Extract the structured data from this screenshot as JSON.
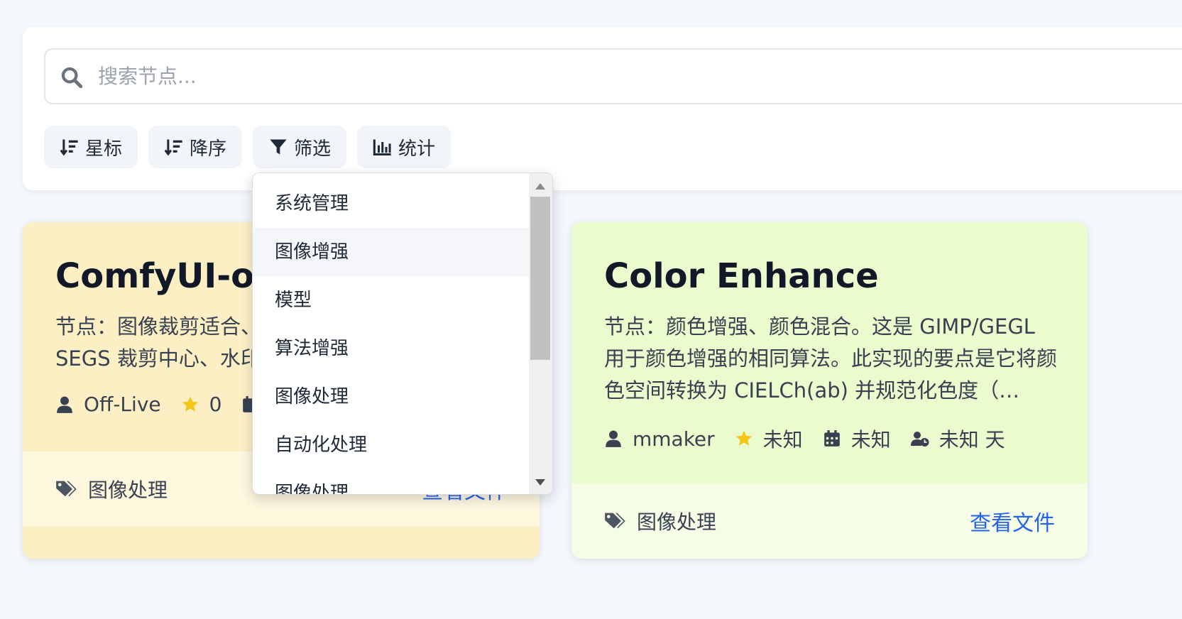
{
  "search": {
    "placeholder": "搜索节点..."
  },
  "toolbar": {
    "star_label": "星标",
    "order_label": "降序",
    "filter_label": "筛选",
    "stats_label": "统计"
  },
  "dropdown": {
    "items": [
      "系统管理",
      "图像增强",
      "模型",
      "算法增强",
      "图像处理",
      "自动化处理",
      "图像处理"
    ],
    "selected": "图像增强"
  },
  "cards": [
    {
      "title": "ComfyUI-off",
      "desc_line1": "节点：图像裁剪适合、",
      "desc_line2": "SEGS 裁剪中心、水印",
      "author": "Off-Live",
      "stars": "0",
      "tag": "图像处理",
      "link": "查看文件"
    },
    {
      "title": "Color Enhance",
      "desc": "节点：颜色增强、颜色混合。这是 GIMP/GEGL 用于颜色增强的相同算法。此实现的要点是它将颜色空间转换为 CIELCh(ab) 并规范化色度（…",
      "author": "mmaker",
      "stars": "未知",
      "date": "未知",
      "age": "未知 天",
      "tag": "图像处理",
      "link": "查看文件"
    }
  ],
  "colors": {
    "accent": "#2563eb",
    "star": "#f5c518",
    "card1_bg": "#fdefc4",
    "card2_bg": "#eafbcd"
  },
  "icons": [
    "search-icon",
    "sort-icon",
    "filter-icon",
    "chart-icon",
    "user-icon",
    "star-icon",
    "calendar-icon",
    "user-clock-icon",
    "tags-icon"
  ]
}
